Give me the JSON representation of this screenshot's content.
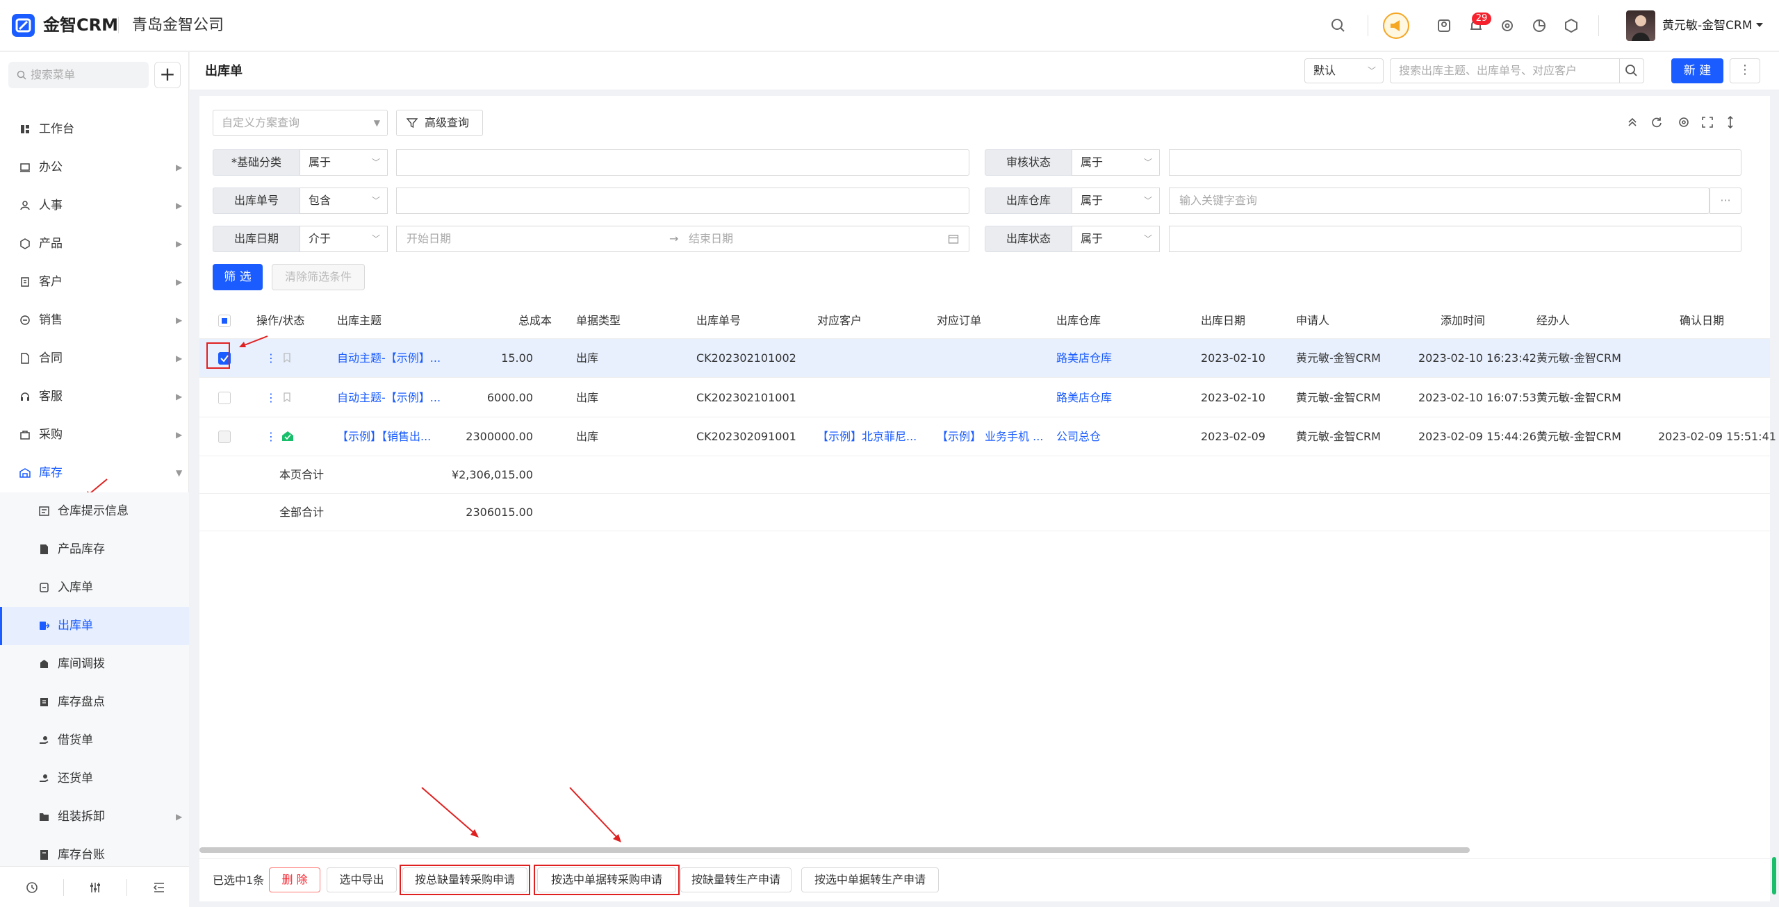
{
  "header": {
    "brand": "金智CRM",
    "company": "青岛金智公司",
    "notification_count": "29",
    "user_name": "黄元敏-金智CRM"
  },
  "sidebar": {
    "search_placeholder": "搜索菜单",
    "add_label": "+",
    "items": [
      {
        "label": "工作台",
        "icon": "dashboard-icon"
      },
      {
        "label": "办公",
        "icon": "office-icon"
      },
      {
        "label": "人事",
        "icon": "people-icon"
      },
      {
        "label": "产品",
        "icon": "product-icon"
      },
      {
        "label": "客户",
        "icon": "customer-icon"
      },
      {
        "label": "销售",
        "icon": "sales-icon"
      },
      {
        "label": "合同",
        "icon": "contract-icon"
      },
      {
        "label": "客服",
        "icon": "service-icon"
      },
      {
        "label": "采购",
        "icon": "purchase-icon"
      },
      {
        "label": "库存",
        "icon": "warehouse-icon"
      }
    ],
    "sub_items": [
      {
        "label": "仓库提示信息",
        "icon": "info-icon"
      },
      {
        "label": "产品库存",
        "icon": "stock-icon"
      },
      {
        "label": "入库单",
        "icon": "inbound-icon"
      },
      {
        "label": "出库单",
        "icon": "outbound-icon"
      },
      {
        "label": "库间调拨",
        "icon": "transfer-icon"
      },
      {
        "label": "库存盘点",
        "icon": "inventory-check-icon"
      },
      {
        "label": "借货单",
        "icon": "borrow-icon"
      },
      {
        "label": "还货单",
        "icon": "return-icon"
      },
      {
        "label": "组装拆卸",
        "icon": "assembly-icon"
      },
      {
        "label": "库存台账",
        "icon": "ledger-icon"
      }
    ]
  },
  "page": {
    "title": "出库单",
    "view_select": "默认",
    "search_placeholder": "搜索出库主题、出库单号、对应客户",
    "new_label": "新 建",
    "more_label": "⋮"
  },
  "filters": {
    "scheme_placeholder": "自定义方案查询",
    "advanced_label": "高级查询",
    "rows": [
      {
        "label": "*基础分类",
        "op": "属于",
        "value": ""
      },
      {
        "label": "出库单号",
        "op": "包含",
        "value": ""
      },
      {
        "label": "出库日期",
        "op": "介于",
        "start_placeholder": "开始日期",
        "end_placeholder": "结束日期"
      },
      {
        "label": "审核状态",
        "op": "属于",
        "value": ""
      },
      {
        "label": "出库仓库",
        "op": "属于",
        "placeholder": "输入关键字查询"
      },
      {
        "label": "出库状态",
        "op": "属于",
        "value": ""
      }
    ],
    "filter_label": "筛 选",
    "clear_label": "清除筛选条件"
  },
  "table": {
    "columns": [
      "操作/状态",
      "出库主题",
      "总成本",
      "单据类型",
      "出库单号",
      "对应客户",
      "对应订单",
      "出库仓库",
      "出库日期",
      "申请人",
      "添加时间",
      "经办人",
      "确认日期"
    ],
    "rows": [
      {
        "subject": "自动主题-【示例】...",
        "cost": "15.00",
        "type": "出库",
        "no": "CK202302101002",
        "customer": "",
        "order": "",
        "warehouse": "路美店仓库",
        "date": "2023-02-10",
        "applicant": "黄元敏-金智CRM",
        "added": "2023-02-10 16:23:42",
        "handler": "黄元敏-金智CRM",
        "confirm": "",
        "selected": true
      },
      {
        "subject": "自动主题-【示例】...",
        "cost": "6000.00",
        "type": "出库",
        "no": "CK202302101001",
        "customer": "",
        "order": "",
        "warehouse": "路美店仓库",
        "date": "2023-02-10",
        "applicant": "黄元敏-金智CRM",
        "added": "2023-02-10 16:07:53",
        "handler": "黄元敏-金智CRM",
        "confirm": "",
        "selected": false
      },
      {
        "subject": "【示例】【销售出...",
        "cost": "2300000.00",
        "type": "出库",
        "no": "CK202302091001",
        "customer": "【示例】北京菲尼...",
        "order": "【示例】 业务手机 ...",
        "warehouse": "公司总仓",
        "date": "2023-02-09",
        "applicant": "黄元敏-金智CRM",
        "added": "2023-02-09 15:44:26",
        "handler": "黄元敏-金智CRM",
        "confirm": "2023-02-09 15:51:41",
        "selected": false
      }
    ],
    "page_total_label": "本页合计",
    "page_total_value": "¥2,306,015.00",
    "all_total_label": "全部合计",
    "all_total_value": "2306015.00"
  },
  "footer": {
    "selected_text": "已选中1条",
    "buttons": [
      "删 除",
      "选中导出",
      "按总缺量转采购申请",
      "按选中单据转采购申请",
      "按缺量转生产申请",
      "按选中单据转生产申请"
    ]
  },
  "colors": {
    "primary": "#1a5cff",
    "danger": "#f5222d",
    "annotation": "#e02020"
  }
}
